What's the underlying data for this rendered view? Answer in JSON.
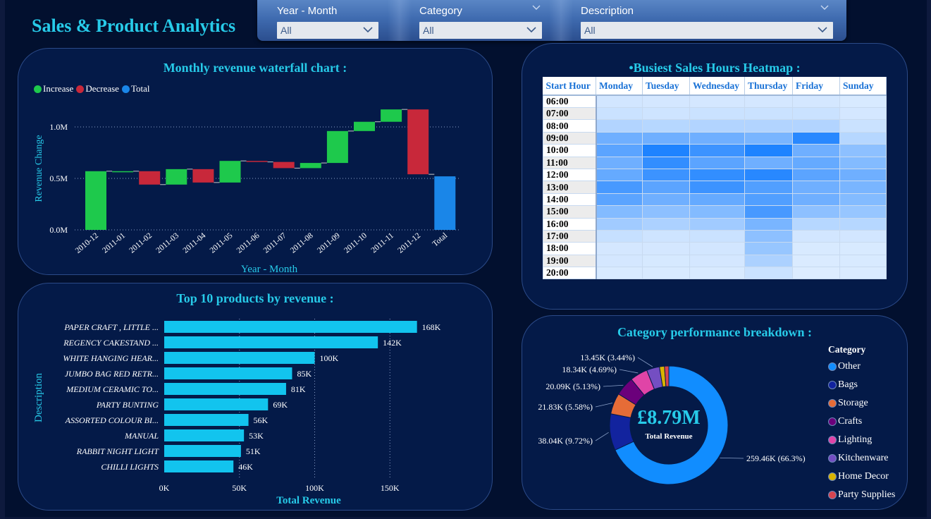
{
  "page": {
    "title": "Sales & Product Analytics"
  },
  "slicers": [
    {
      "label": "Year - Month",
      "value": "All"
    },
    {
      "label": "Category",
      "value": "All"
    },
    {
      "label": "Description",
      "value": "All"
    }
  ],
  "waterfall": {
    "title": "Monthly revenue waterfall chart :",
    "legend": [
      {
        "label": "Increase",
        "color": "#1ec94c"
      },
      {
        "label": "Decrease",
        "color": "#c8283a"
      },
      {
        "label": "Total",
        "color": "#1a86e8"
      }
    ],
    "ylabel": "Revenue Change",
    "xlabel": "Year - Month",
    "yticks": [
      "0.0M",
      "0.5M",
      "1.0M"
    ]
  },
  "heatmap": {
    "title": "•Busiest Sales Hours Heatmap :",
    "corner": "Start Hour",
    "days": [
      "Monday",
      "Tuesday",
      "Wednesday",
      "Thursday",
      "Friday",
      "Sunday"
    ],
    "hours": [
      "06:00",
      "07:00",
      "08:00",
      "09:00",
      "10:00",
      "11:00",
      "12:00",
      "13:00",
      "14:00",
      "15:00",
      "16:00",
      "17:00",
      "18:00",
      "19:00",
      "20:00"
    ]
  },
  "products": {
    "title": "Top 10 products by revenue :",
    "ylabel": "Description",
    "xlabel": "Total Revenue",
    "xticks": [
      "0K",
      "50K",
      "100K",
      "150K"
    ]
  },
  "category": {
    "title": "Category performance breakdown :",
    "center_value": "£8.79M",
    "center_label": "Total Revenue",
    "legend_title": "Category"
  },
  "chart_data": [
    {
      "type": "bar",
      "subtype": "waterfall",
      "title": "Monthly revenue waterfall chart :",
      "xlabel": "Year - Month",
      "ylabel": "Revenue Change",
      "ylim": [
        0,
        1.2
      ],
      "unit": "M",
      "grid": true,
      "legend": "top-left",
      "categories": [
        "2010-12",
        "2011-01",
        "2011-02",
        "2011-03",
        "2011-04",
        "2011-05",
        "2011-06",
        "2011-07",
        "2011-08",
        "2011-09",
        "2011-10",
        "2011-11",
        "2011-12",
        "Total"
      ],
      "values": [
        0.57,
        0.0,
        -0.13,
        0.15,
        -0.13,
        0.21,
        -0.01,
        -0.06,
        0.05,
        0.31,
        0.09,
        0.12,
        -0.63,
        0.52
      ],
      "kinds": [
        "increase",
        "increase",
        "decrease",
        "increase",
        "decrease",
        "increase",
        "decrease",
        "decrease",
        "increase",
        "increase",
        "increase",
        "increase",
        "decrease",
        "total"
      ]
    },
    {
      "type": "heatmap",
      "title": "•Busiest Sales Hours Heatmap :",
      "x": [
        "Monday",
        "Tuesday",
        "Wednesday",
        "Thursday",
        "Friday",
        "Sunday"
      ],
      "y": [
        "06:00",
        "07:00",
        "08:00",
        "09:00",
        "10:00",
        "11:00",
        "12:00",
        "13:00",
        "14:00",
        "15:00",
        "16:00",
        "17:00",
        "18:00",
        "19:00",
        "20:00"
      ],
      "values": [
        [
          0.06,
          0.05,
          0.05,
          0.05,
          0.05,
          0.03
        ],
        [
          0.1,
          0.08,
          0.1,
          0.1,
          0.1,
          0.05
        ],
        [
          0.22,
          0.2,
          0.22,
          0.22,
          0.22,
          0.1
        ],
        [
          0.55,
          0.55,
          0.55,
          0.5,
          0.9,
          0.2
        ],
        [
          0.65,
          0.95,
          0.8,
          0.95,
          0.55,
          0.4
        ],
        [
          0.55,
          0.85,
          0.65,
          0.55,
          0.6,
          0.45
        ],
        [
          0.6,
          0.8,
          0.85,
          0.9,
          0.65,
          0.55
        ],
        [
          0.75,
          0.65,
          0.8,
          0.7,
          0.55,
          0.5
        ],
        [
          0.65,
          0.55,
          0.6,
          0.7,
          0.55,
          0.45
        ],
        [
          0.45,
          0.4,
          0.45,
          0.75,
          0.4,
          0.35
        ],
        [
          0.3,
          0.25,
          0.3,
          0.5,
          0.2,
          0.2
        ],
        [
          0.12,
          0.08,
          0.1,
          0.4,
          0.06,
          0.06
        ],
        [
          0.05,
          0.05,
          0.06,
          0.35,
          0.03,
          0.03
        ],
        [
          0.05,
          0.04,
          0.05,
          0.25,
          0.02,
          0.03
        ],
        [
          0.03,
          0.03,
          0.03,
          0.1,
          0.01,
          0.02
        ]
      ]
    },
    {
      "type": "bar",
      "orientation": "horizontal",
      "title": "Top 10 products by revenue :",
      "xlabel": "Total Revenue",
      "ylabel": "Description",
      "xlim": [
        0,
        170
      ],
      "unit": "K",
      "categories": [
        "PAPER CRAFT , LITTLE ...",
        "REGENCY CAKESTAND ...",
        "WHITE HANGING HEAR...",
        "JUMBO BAG RED RETR...",
        "MEDIUM CERAMIC TO...",
        "PARTY BUNTING",
        "ASSORTED COLOUR BI...",
        "MANUAL",
        "RABBIT NIGHT LIGHT",
        "CHILLI LIGHTS"
      ],
      "values": [
        168,
        142,
        100,
        85,
        81,
        69,
        56,
        53,
        51,
        46
      ],
      "labels": [
        "168K",
        "142K",
        "100K",
        "85K",
        "81K",
        "69K",
        "56K",
        "53K",
        "51K",
        "46K"
      ]
    },
    {
      "type": "pie",
      "subtype": "donut",
      "title": "Category performance breakdown :",
      "legend": "right",
      "categories": [
        "Other",
        "Bags",
        "Storage",
        "Crafts",
        "Lighting",
        "Kitchenware",
        "Home Decor",
        "Party Supplies"
      ],
      "values": [
        259.46,
        38.04,
        21.83,
        20.09,
        18.34,
        13.45,
        5.2,
        4.5
      ],
      "colors": [
        "#118dff",
        "#12239e",
        "#e66c37",
        "#6b007b",
        "#e044a7",
        "#744ec2",
        "#d9b300",
        "#d64550"
      ],
      "labels": [
        "259.46K (66.3%)",
        "38.04K (9.72%)",
        "21.83K (5.58%)",
        "20.09K (5.13%)",
        "18.34K (4.69%)",
        "13.45K (3.44%)",
        "",
        ""
      ]
    }
  ]
}
